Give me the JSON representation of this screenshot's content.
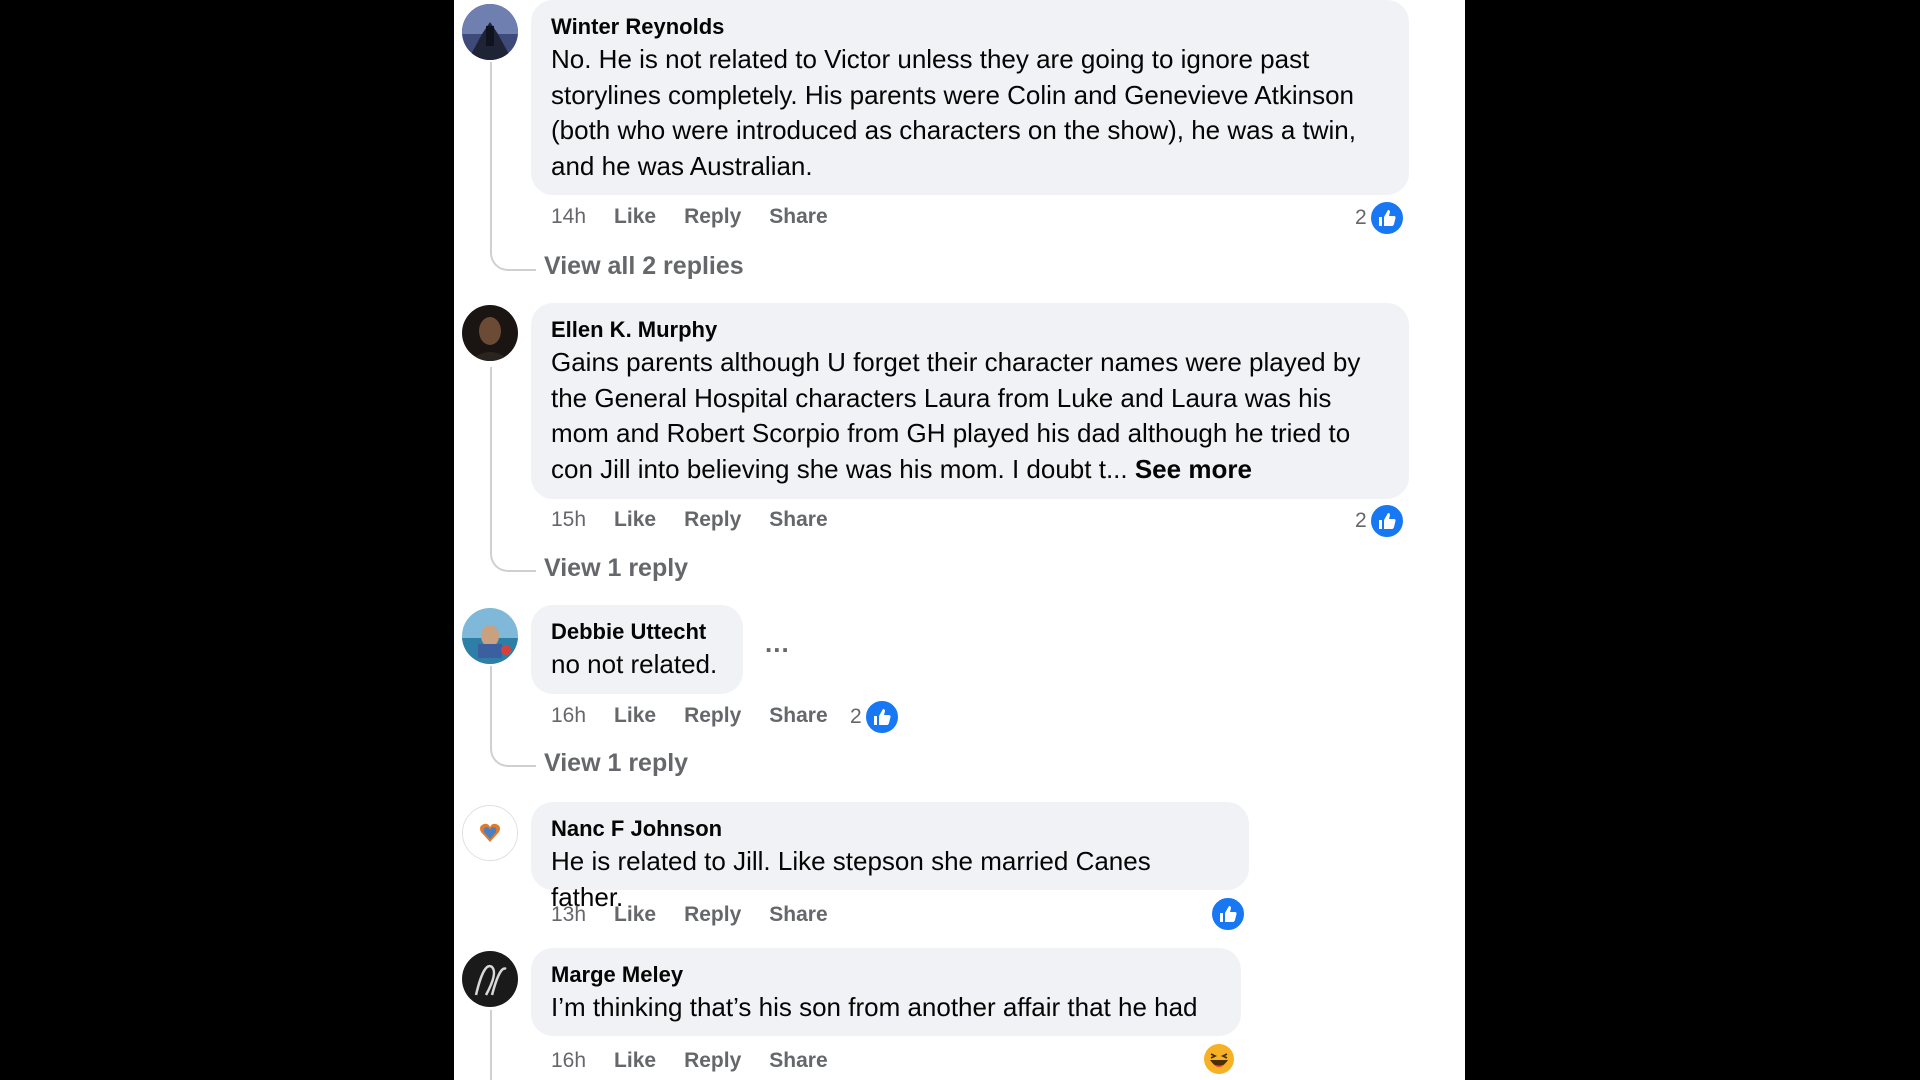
{
  "comments": [
    {
      "author": "Winter Reynolds",
      "text": "No. He is not related to Victor unless they are going to ignore past storylines completely. His parents were Colin and Genevieve Atkinson (both who were introduced as characters on the show), he was a twin, and he was Australian.",
      "time": "14h",
      "like": "Like",
      "reply": "Reply",
      "share": "Share",
      "reaction_count": "2",
      "view_replies": "View all 2 replies"
    },
    {
      "author": "Ellen K. Murphy",
      "text": "Gains parents although U forget their character names were played by the General Hospital characters Laura from Luke and Laura was his mom and Robert Scorpio from GH played his dad although he tried to con Jill into believing she was his mom. I doubt t...",
      "see_more": "See more",
      "time": "15h",
      "like": "Like",
      "reply": "Reply",
      "share": "Share",
      "reaction_count": "2",
      "view_replies": "View 1 reply"
    },
    {
      "author": "Debbie Uttecht",
      "text": "no not related.",
      "time": "16h",
      "like": "Like",
      "reply": "Reply",
      "share": "Share",
      "reaction_count": "2",
      "more_options": "...",
      "view_replies": "View 1 reply"
    },
    {
      "author": "Nanc F Johnson",
      "text": "He is related to Jill. Like stepson she married Canes father.",
      "time": "13h",
      "like": "Like",
      "reply": "Reply",
      "share": "Share",
      "reaction": "like-icon"
    },
    {
      "author": "Marge Meley",
      "text": "I’m thinking that’s his son from another affair that he had",
      "time": "16h",
      "like": "Like",
      "reply": "Reply",
      "share": "Share",
      "reaction": "haha-icon"
    }
  ],
  "colors": {
    "background": "#000000",
    "panel": "#ffffff",
    "bubble": "#f0f2f5",
    "secondary_text": "#65676b",
    "like_blue": "#1877f2"
  }
}
